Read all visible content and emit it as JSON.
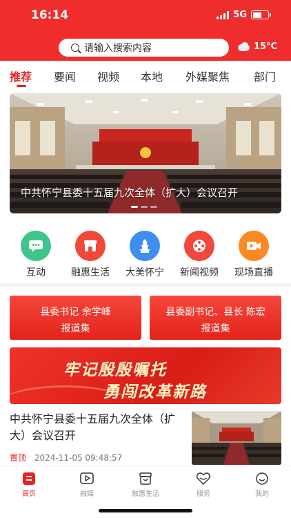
{
  "status_bar": {
    "time": "16:14",
    "network": "5G"
  },
  "header": {
    "search_placeholder": "请输入搜索内容",
    "weather_icon": "cloud-icon",
    "temperature": "15°C",
    "brand_color": "#ee2d2c"
  },
  "tabs": [
    "推荐",
    "要闻",
    "视频",
    "本地",
    "外媒聚焦",
    "部门"
  ],
  "banner": {
    "caption": "中共怀宁县委十五届九次全体（扩大）会议召开"
  },
  "quick_entries": [
    {
      "label": "互动",
      "icon": "chat-bubble-icon",
      "color": "#3fc58b"
    },
    {
      "label": "融惠生活",
      "icon": "shop-icon",
      "color": "#f0493b"
    },
    {
      "label": "大美怀宁",
      "icon": "pagoda-icon",
      "color": "#3d8ef0"
    },
    {
      "label": "新闻视频",
      "icon": "film-reel-icon",
      "color": "#f0493b"
    },
    {
      "label": "现场直播",
      "icon": "live-camera-icon",
      "color": "#f98a23"
    }
  ],
  "promo_buttons": [
    {
      "line1": "县委书记 余学峰",
      "line2": "报道集"
    },
    {
      "line1": "县委副书记、县长 陈宏",
      "line2": "报道集"
    }
  ],
  "slogan": {
    "line1": "牢记殷殷嘱托",
    "line2": "勇闯改革新路"
  },
  "news": {
    "title": "中共怀宁县委十五届九次全体（扩大）会议召开",
    "pin": "置顶",
    "timestamp": "2024-11-05 09:48:57"
  },
  "tabbar": [
    {
      "label": "首页",
      "icon": "home-icon",
      "active": true
    },
    {
      "label": "融媒",
      "icon": "video-play-icon",
      "active": false
    },
    {
      "label": "融惠生活",
      "icon": "shop-icon",
      "active": false
    },
    {
      "label": "服务",
      "icon": "heart-icon",
      "active": false
    },
    {
      "label": "我的",
      "icon": "user-smile-icon",
      "active": false
    }
  ]
}
